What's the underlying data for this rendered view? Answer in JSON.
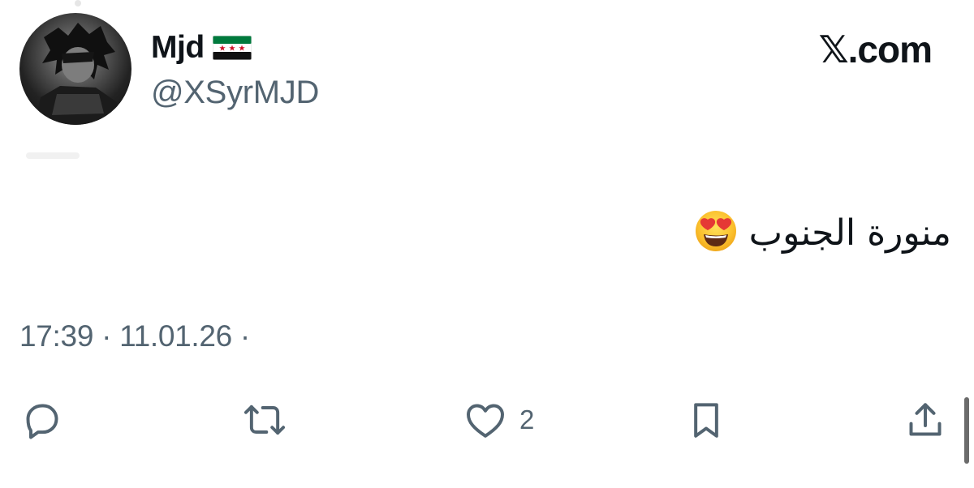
{
  "author": {
    "display_name": "Mjd",
    "handle": "@XSyrMJD",
    "flag_icon": "syrian-independence-flag-icon"
  },
  "brand": {
    "label": "𝕏.com"
  },
  "tweet": {
    "text": "منورة الجنوب",
    "emoji": "😍"
  },
  "meta": {
    "timestamp": "17:39 · 11.01.26 ·"
  },
  "actions": {
    "reply_icon": "reply-icon",
    "retweet_icon": "retweet-icon",
    "like_icon": "heart-icon",
    "like_count": "2",
    "bookmark_icon": "bookmark-icon",
    "share_icon": "share-icon"
  },
  "colors": {
    "text": "#0f1419",
    "secondary": "#536471",
    "background": "#ffffff"
  }
}
